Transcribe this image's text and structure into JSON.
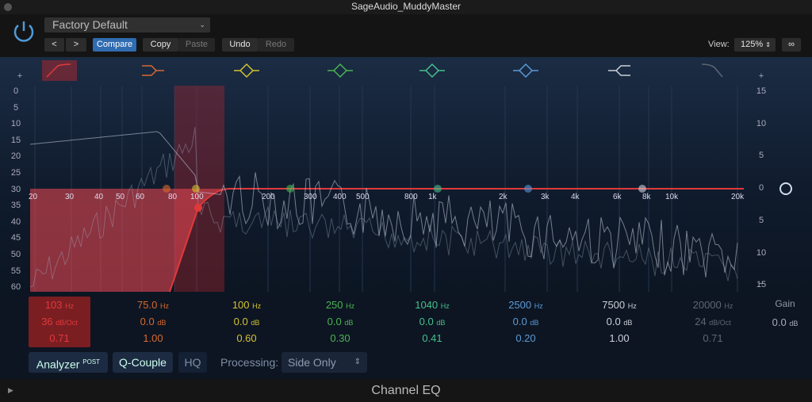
{
  "window": {
    "title": "SageAudio_MuddyMaster"
  },
  "header": {
    "preset": "Factory Default",
    "prev": "<",
    "next": ">",
    "compare": "Compare",
    "copy": "Copy",
    "paste": "Paste",
    "undo": "Undo",
    "redo": "Redo",
    "view_label": "View:",
    "view_value": "125%"
  },
  "graph": {
    "left_scale": [
      "+",
      "0",
      "5",
      "10",
      "15",
      "20",
      "25",
      "30",
      "35",
      "40",
      "45",
      "50",
      "55",
      "60"
    ],
    "right_scale": [
      "+",
      "15",
      "10",
      "5",
      "0",
      "5",
      "10",
      "15",
      "−"
    ],
    "freq_labels": [
      "20",
      "30",
      "40",
      "50",
      "60",
      "80",
      "100",
      "200",
      "300",
      "400",
      "500",
      "800",
      "1k",
      "2k",
      "3k",
      "4k",
      "6k",
      "8k",
      "10k",
      "20k"
    ],
    "colors": {
      "band1": "#d9383a",
      "band2": "#d8692e",
      "band3": "#cfc42f",
      "band4": "#3fae4c",
      "band5": "#3fbd8c",
      "band6": "#4a8fd1",
      "band7": "#b9c2cc",
      "band8": "#7d8590"
    }
  },
  "bands": [
    {
      "icon": "low-cut-icon",
      "freq": "103",
      "freq_unit": "Hz",
      "gain": "36",
      "gain_unit": "dB/Oct",
      "q": "0.71",
      "color": "#e0393b"
    },
    {
      "icon": "low-shelf-icon",
      "freq": "75.0",
      "freq_unit": "Hz",
      "gain": "0.0",
      "gain_unit": "dB",
      "q": "1.00",
      "color": "#d8692e"
    },
    {
      "icon": "bell-icon",
      "freq": "100",
      "freq_unit": "Hz",
      "gain": "0.0",
      "gain_unit": "dB",
      "q": "0.60",
      "color": "#d2c232"
    },
    {
      "icon": "bell-icon",
      "freq": "250",
      "freq_unit": "Hz",
      "gain": "0.0",
      "gain_unit": "dB",
      "q": "0.30",
      "color": "#4bb453"
    },
    {
      "icon": "bell-icon",
      "freq": "1040",
      "freq_unit": "Hz",
      "gain": "0.0",
      "gain_unit": "dB",
      "q": "0.41",
      "color": "#45c08c"
    },
    {
      "icon": "bell-icon",
      "freq": "2500",
      "freq_unit": "Hz",
      "gain": "0.0",
      "gain_unit": "dB",
      "q": "0.20",
      "color": "#5a9ad6"
    },
    {
      "icon": "high-shelf-icon",
      "freq": "7500",
      "freq_unit": "Hz",
      "gain": "0.0",
      "gain_unit": "dB",
      "q": "1.00",
      "color": "#c9d0d8"
    },
    {
      "icon": "high-cut-icon",
      "freq": "20000",
      "freq_unit": "Hz",
      "gain": "24",
      "gain_unit": "dB/Oct",
      "q": "0.71",
      "color": "#5d6672"
    }
  ],
  "gain": {
    "label": "Gain",
    "value": "0.0",
    "unit": "dB"
  },
  "controls": {
    "analyzer": "Analyzer",
    "analyzer_badge": "POST",
    "qcouple": "Q-Couple",
    "hq": "HQ",
    "processing_label": "Processing:",
    "processing_value": "Side Only"
  },
  "footer": {
    "title": "Channel EQ"
  }
}
